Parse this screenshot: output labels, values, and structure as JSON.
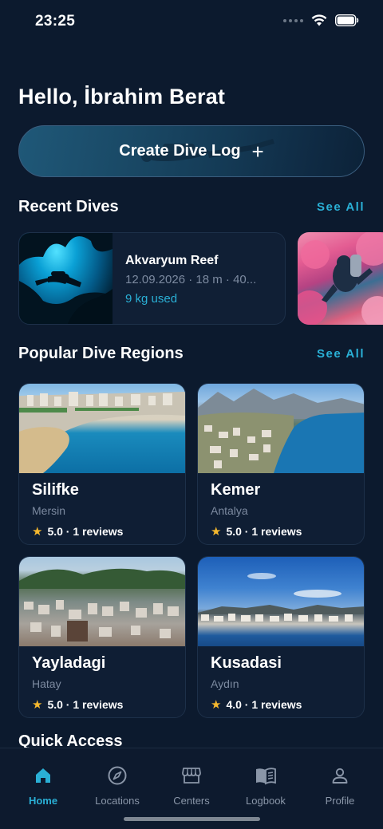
{
  "status_bar": {
    "time": "23:25"
  },
  "greeting": "Hello, İbrahim Berat",
  "create_button": {
    "label": "Create Dive Log",
    "plus": "+"
  },
  "recent_dives": {
    "title": "Recent Dives",
    "see_all": "See All",
    "items": [
      {
        "name": "Akvaryum Reef",
        "meta": "12.09.2026 · 18 m · 40...",
        "weight": "9 kg used"
      }
    ]
  },
  "popular_regions": {
    "title": "Popular Dive Regions",
    "see_all": "See All",
    "items": [
      {
        "name": "Silifke",
        "location": "Mersin",
        "rating": "5.0 · 1 reviews"
      },
      {
        "name": "Kemer",
        "location": "Antalya",
        "rating": "5.0 · 1 reviews"
      },
      {
        "name": "Yayladagi",
        "location": "Hatay",
        "rating": "5.0 · 1 reviews"
      },
      {
        "name": "Kusadasi",
        "location": "Aydın",
        "rating": "4.0 · 1 reviews"
      }
    ]
  },
  "quick_access": {
    "title": "Quick Access"
  },
  "tabs": [
    {
      "label": "Home",
      "icon": "home-icon",
      "active": true
    },
    {
      "label": "Locations",
      "icon": "compass-icon",
      "active": false
    },
    {
      "label": "Centers",
      "icon": "store-icon",
      "active": false
    },
    {
      "label": "Logbook",
      "icon": "book-icon",
      "active": false
    },
    {
      "label": "Profile",
      "icon": "person-icon",
      "active": false
    }
  ],
  "colors": {
    "background": "#0c1a2e",
    "accent": "#2ab0d6",
    "muted": "#7c8aa0",
    "star": "#f5b82e"
  }
}
